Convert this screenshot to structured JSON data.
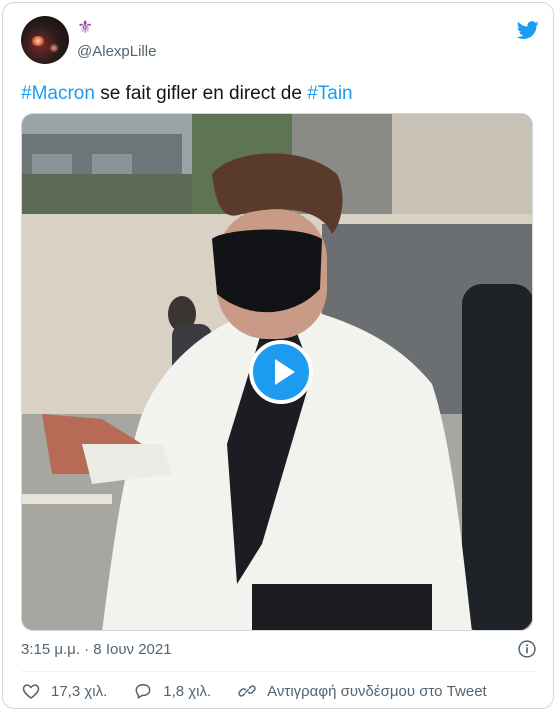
{
  "author": {
    "badge_glyph": "⚜",
    "handle": "@AlexpLille"
  },
  "tweet": {
    "hashtag_1": "#Macron",
    "text_middle": " se fait gifler en direct de ",
    "hashtag_2": "#Tain"
  },
  "media": {
    "type": "video",
    "play_icon": "play-icon"
  },
  "meta": {
    "timestamp": "3:15 μ.μ. · 8 Ιουν 2021"
  },
  "actions": {
    "likes": "17,3 χιλ.",
    "replies": "1,8 χιλ.",
    "copy_link": "Αντιγραφή συνδέσμου στο Tweet"
  },
  "colors": {
    "accent": "#1d9bf0",
    "secondary_text": "#536471",
    "border": "#cfd9de"
  }
}
